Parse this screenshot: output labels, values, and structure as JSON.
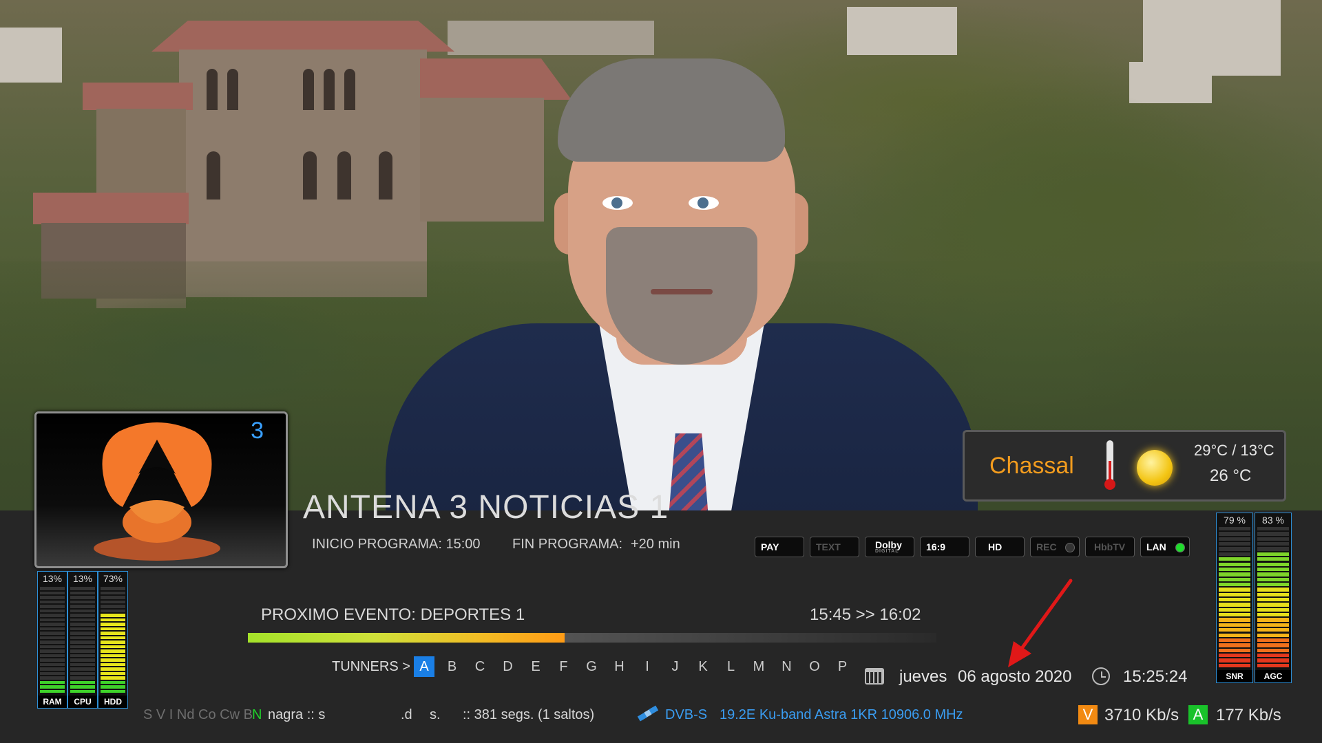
{
  "channel": {
    "number": "3",
    "logo_icon": "antena3-logo-icon",
    "program_title": "ANTENA 3 NOTICIAS 1"
  },
  "program": {
    "start_label": "INICIO PROGRAMA: 15:00",
    "end_label": "FIN PROGRAMA:",
    "end_value": "+20 min"
  },
  "flags": [
    {
      "label": "PAY",
      "active": true
    },
    {
      "label": "TEXT",
      "active": false
    },
    {
      "label": "Dolby",
      "sub": "DIGITAL",
      "active": true
    },
    {
      "label": "16:9",
      "active": true
    },
    {
      "label": "HD",
      "active": true
    },
    {
      "label": "REC",
      "active": false
    },
    {
      "label": "HbbTV",
      "active": false
    },
    {
      "label": "LAN",
      "active": true
    }
  ],
  "weather": {
    "city": "Chassal",
    "range": "29°C / 13°C",
    "current": "26 °C"
  },
  "system_meters": [
    {
      "name": "RAM",
      "percent_label": "13%",
      "value": 13
    },
    {
      "name": "CPU",
      "percent_label": "13%",
      "value": 13
    },
    {
      "name": "HDD",
      "percent_label": "73%",
      "value": 73
    }
  ],
  "signal_meters": [
    {
      "name": "SNR",
      "percent_label": "79 %",
      "value": 79
    },
    {
      "name": "AGC",
      "percent_label": "83 %",
      "value": 83
    }
  ],
  "next_event": {
    "label": "PROXIMO EVENTO:  DEPORTES 1",
    "time": "15:45 >> 16:02",
    "progress": 0.46
  },
  "tuners": {
    "label": "TUNNERS >",
    "letters": [
      "A",
      "B",
      "C",
      "D",
      "E",
      "F",
      "G",
      "H",
      "I",
      "J",
      "K",
      "L",
      "M",
      "N",
      "O",
      "P"
    ],
    "active": "A"
  },
  "datetime": {
    "day": "jueves",
    "date": "06 agosto 2020",
    "time": "15:25:24"
  },
  "status_line": {
    "cas_systems": "S V I Nd Co Cw B",
    "cas_active": "N",
    "cas_name": "nagra :: s",
    "fragment_1": ".d",
    "fragment_2": "s.",
    "segments": ":: 381 segs. (1 saltos)",
    "delivery": "DVB-S",
    "transponder": "19.2E Ku-band Astra 1KR 10906.0 MHz",
    "video_badge": "V",
    "video_rate": "3710 Kb/s",
    "audio_badge": "A",
    "audio_rate": "177 Kb/s"
  },
  "colors": {
    "accent_blue": "#1a7fe6",
    "weather_city": "#f39c1e",
    "video_badge": "#f28a12",
    "audio_badge": "#19c22a",
    "logo_orange": "#f4782a",
    "logo_brown": "#b5542a"
  }
}
